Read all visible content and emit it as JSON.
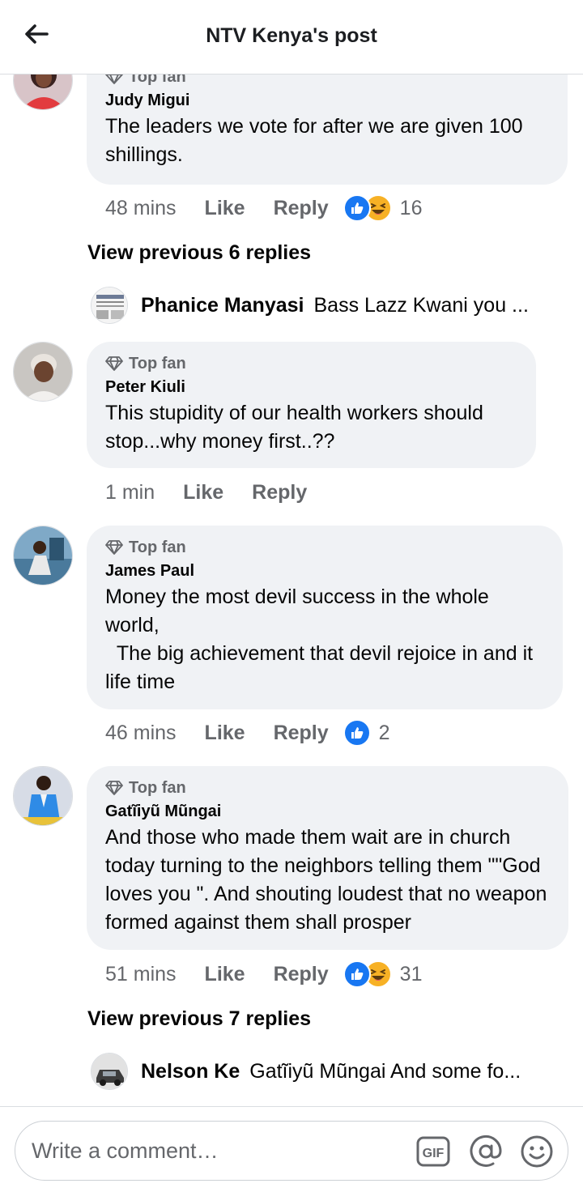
{
  "header": {
    "title": "NTV Kenya's post"
  },
  "comments": [
    {
      "badge": "Top fan",
      "author": "Judy Migui",
      "text": "The leaders we vote for after we are given 100 shillings.",
      "time": "48 mins",
      "like": "Like",
      "reply": "Reply",
      "reactions": [
        "like",
        "haha"
      ],
      "reaction_count": "16"
    },
    {
      "badge": "Top fan",
      "author": "Peter Kiuli",
      "text": "This stupidity of our health workers should stop...why money first..??",
      "time": "1 min",
      "like": "Like",
      "reply": "Reply"
    },
    {
      "badge": "Top fan",
      "author": "James Paul",
      "text": "Money the most devil success in the whole world,\n  The big achievement that devil rejoice in and it life time",
      "time": "46 mins",
      "like": "Like",
      "reply": "Reply",
      "reactions": [
        "like"
      ],
      "reaction_count": "2"
    },
    {
      "badge": "Top fan",
      "author": "Gatĩiyũ Mũngai",
      "text": "And those who made them wait are in church today turning to the neighbors telling them \"\"God loves you \". And shouting loudest that no weapon formed against them shall prosper",
      "time": "51 mins",
      "like": "Like",
      "reply": "Reply",
      "reactions": [
        "like",
        "haha"
      ],
      "reaction_count": "31"
    }
  ],
  "view_previous": [
    "View previous 6 replies",
    "View previous 7 replies"
  ],
  "replies": [
    {
      "name": "Phanice Manyasi",
      "snippet": "Bass Lazz Kwani you ..."
    },
    {
      "name": "Nelson Ke",
      "snippet": "Gatĩiyũ Mũngai And some fo..."
    }
  ],
  "composer": {
    "placeholder": "Write a comment…",
    "gif_label": "GIF"
  },
  "colors": {
    "like_blue": "#1877f2",
    "haha_yellow": "#f7b125",
    "bubble_gray": "#f0f2f5",
    "secondary_text": "#65676b"
  },
  "icons": [
    "back-arrow-icon",
    "top-fan-badge-icon",
    "like-reaction-icon",
    "haha-reaction-icon",
    "gif-icon",
    "mention-icon",
    "emoji-icon"
  ]
}
